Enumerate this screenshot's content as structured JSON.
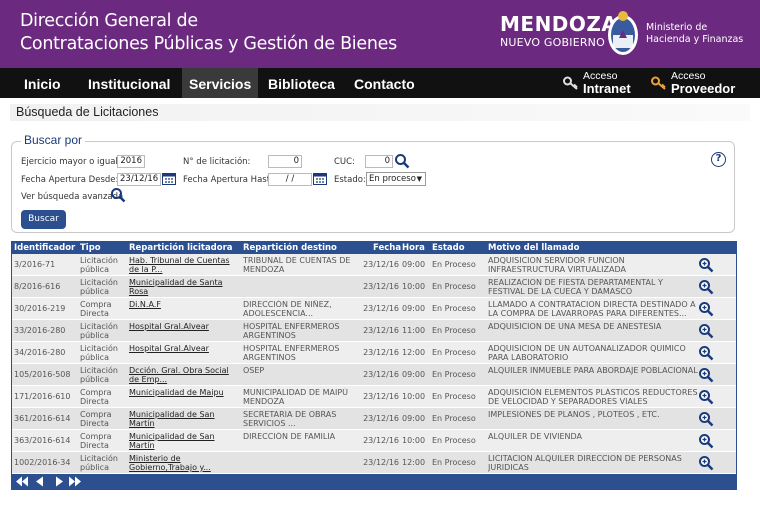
{
  "header": {
    "title_line1": "Dirección General de",
    "title_line2": "Contrataciones Públicas y Gestión de Bienes",
    "logo_main": "MENDOZA",
    "logo_sub": "NUEVO GOBIERNO",
    "ministry_line1": "Ministerio de",
    "ministry_line2": "Hacienda y Finanzas"
  },
  "nav": {
    "items": [
      {
        "label": "Inicio"
      },
      {
        "label": "Institucional"
      },
      {
        "label": "Servicios"
      },
      {
        "label": "Biblioteca"
      },
      {
        "label": "Contacto"
      }
    ],
    "active": "Servicios",
    "access_intranet_line1": "Acceso",
    "access_intranet_line2": "Intranet",
    "access_proveedor_line1": "Acceso",
    "access_proveedor_line2": "Proveedor"
  },
  "page": {
    "title": "Búsqueda de Licitaciones"
  },
  "search": {
    "legend": "Buscar por",
    "ejercicio_label": "Ejercicio mayor o igual a:",
    "ejercicio_value": "2016",
    "nro_label": "N° de licitación:",
    "nro_value": "0",
    "cuc_label": "CUC:",
    "cuc_value": "0",
    "fecha_desde_label": "Fecha Apertura Desde:",
    "fecha_desde_value": "23/12/16",
    "fecha_hasta_label": "Fecha Apertura Hasta:",
    "fecha_hasta_value": "/  /",
    "estado_label": "Estado:",
    "estado_value": "En proceso",
    "advanced_label": "Ver búsqueda avanzada",
    "help_label": "?",
    "button_label": "Buscar"
  },
  "table": {
    "headers": [
      "Identificador",
      "Tipo",
      "Repartición licitadora",
      "Repartición destino",
      "Fecha",
      "Hora",
      "Estado",
      "Motivo del llamado"
    ],
    "rows": [
      {
        "id": "3/2016-71",
        "tipo": "Licitación pública",
        "licitadora": "Hab. Tribunal de Cuentas de la P...",
        "destino": "TRIBUNAL DE CUENTAS DE MENDOZA",
        "fecha": "23/12/16",
        "hora": "09:00",
        "estado": "En Proceso",
        "motivo": "ADQUISICION SERVIDOR FUNCION INFRAESTRUCTURA VIRTUALIZADA"
      },
      {
        "id": "8/2016-616",
        "tipo": "Licitación pública",
        "licitadora": "Municipalidad de Santa Rosa",
        "destino": "",
        "fecha": "23/12/16",
        "hora": "10:00",
        "estado": "En Proceso",
        "motivo": "REALIZACION DE FIESTA DEPARTAMENTAL Y FESTIVAL DE LA CUECA Y DAMASCO"
      },
      {
        "id": "30/2016-219",
        "tipo": "Compra Directa",
        "licitadora": "Di.N.A.F",
        "destino": "DIRECCIÓN DE NIÑEZ, ADOLESCENCIA...",
        "fecha": "23/12/16",
        "hora": "09:00",
        "estado": "En Proceso",
        "motivo": "LLAMADO A CONTRATACION DIRECTA DESTINADO A LA COMPRA DE LAVARROPAS PARA DIFERENTES..."
      },
      {
        "id": "33/2016-280",
        "tipo": "Licitación pública",
        "licitadora": "Hospital Gral.Alvear",
        "destino": "HOSPITAL ENFERMEROS ARGENTINOS",
        "fecha": "23/12/16",
        "hora": "11:00",
        "estado": "En Proceso",
        "motivo": "ADQUISICION DE UNA MESA DE ANESTESIA"
      },
      {
        "id": "34/2016-280",
        "tipo": "Licitación pública",
        "licitadora": "Hospital Gral.Alvear",
        "destino": "HOSPITAL ENFERMEROS ARGENTINOS",
        "fecha": "23/12/16",
        "hora": "12:00",
        "estado": "En Proceso",
        "motivo": "ADQUISICION DE UN AUTOANALIZADOR QUIMICO PARA LABORATORIO"
      },
      {
        "id": "105/2016-508",
        "tipo": "Licitación pública",
        "licitadora": "Dcción. Gral. Obra Social de Emp...",
        "destino": "OSEP",
        "fecha": "23/12/16",
        "hora": "09:00",
        "estado": "En Proceso",
        "motivo": "ALQUILER INMUEBLE PARA ABORDAJE POBLACIONAL"
      },
      {
        "id": "171/2016-610",
        "tipo": "Compra Directa",
        "licitadora": "Municipalidad de Maipu",
        "destino": "MUNICIPALIDAD DE MAIPÚ MENDOZA",
        "fecha": "23/12/16",
        "hora": "10:00",
        "estado": "En Proceso",
        "motivo": "ADQUISICIÓN ELEMENTOS PLÁSTICOS REDUCTORES DE VELOCIDAD Y SEPARADORES VIALES"
      },
      {
        "id": "361/2016-614",
        "tipo": "Compra Directa",
        "licitadora": "Municipalidad de San Martín",
        "destino": "SECRETARIA DE OBRAS SERVICIOS ...",
        "fecha": "23/12/16",
        "hora": "09:00",
        "estado": "En Proceso",
        "motivo": "IMPLESIONES DE PLANOS , PLOTEOS , ETC."
      },
      {
        "id": "363/2016-614",
        "tipo": "Compra Directa",
        "licitadora": "Municipalidad de San Martín",
        "destino": "DIRECCIÓN DE FAMILIA",
        "fecha": "23/12/16",
        "hora": "10:00",
        "estado": "En Proceso",
        "motivo": "ALQUILER DE VIVIENDA"
      },
      {
        "id": "1002/2016-34",
        "tipo": "Licitación pública",
        "licitadora": "Ministerio de Gobierno,Trabajo y...",
        "destino": "",
        "fecha": "23/12/16",
        "hora": "12:00",
        "estado": "En Proceso",
        "motivo": "LICITACION ALQUILER DIRECCION DE PERSONAS JURIDICAS"
      }
    ]
  },
  "colors": {
    "header_bg": "#6b2a7f",
    "nav_bg": "#111111",
    "grid_header_bg": "#2b4f8f",
    "row_odd": "#eeeeee",
    "row_even": "#e3e3e3"
  },
  "icons": {
    "search": "magnifier-icon",
    "calendar": "calendar-icon",
    "key": "key-icon",
    "help": "help-icon",
    "zoom": "zoom-icon",
    "pager": [
      "first-page-icon",
      "prev-page-icon",
      "next-page-icon",
      "last-page-icon"
    ]
  }
}
